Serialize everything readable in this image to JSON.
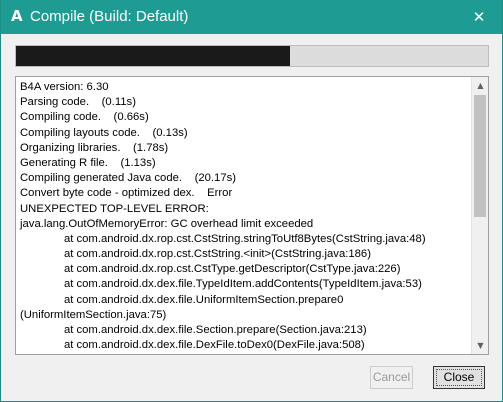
{
  "window": {
    "title": "Compile (Build: Default)",
    "app_icon_glyph": "A",
    "close_glyph": "✕",
    "accent_color": "#1e9c93"
  },
  "progress": {
    "fraction": 0.58
  },
  "log": {
    "lines": [
      "B4A version: 6.30",
      "Parsing code.    (0.11s)",
      "Compiling code.    (0.66s)",
      "Compiling layouts code.    (0.13s)",
      "Organizing libraries.    (1.78s)",
      "Generating R file.    (1.13s)",
      "Compiling generated Java code.    (20.17s)",
      "Convert byte code - optimized dex.    Error",
      "UNEXPECTED TOP-LEVEL ERROR:",
      "java.lang.OutOfMemoryError: GC overhead limit exceeded",
      "              at com.android.dx.rop.cst.CstString.stringToUtf8Bytes(CstString.java:48)",
      "              at com.android.dx.rop.cst.CstString.<init>(CstString.java:186)",
      "              at com.android.dx.rop.cst.CstType.getDescriptor(CstType.java:226)",
      "              at com.android.dx.dex.file.TypeIdItem.addContents(TypeIdItem.java:53)",
      "              at com.android.dx.dex.file.UniformItemSection.prepare0",
      "(UniformItemSection.java:75)",
      "              at com.android.dx.dex.file.Section.prepare(Section.java:213)",
      "              at com.android.dx.dex.file.DexFile.toDex0(DexFile.java:508)"
    ]
  },
  "scrollbar": {
    "up_glyph": "▲",
    "down_glyph": "▼"
  },
  "buttons": {
    "cancel_label": "Cancel",
    "close_label": "Close"
  }
}
